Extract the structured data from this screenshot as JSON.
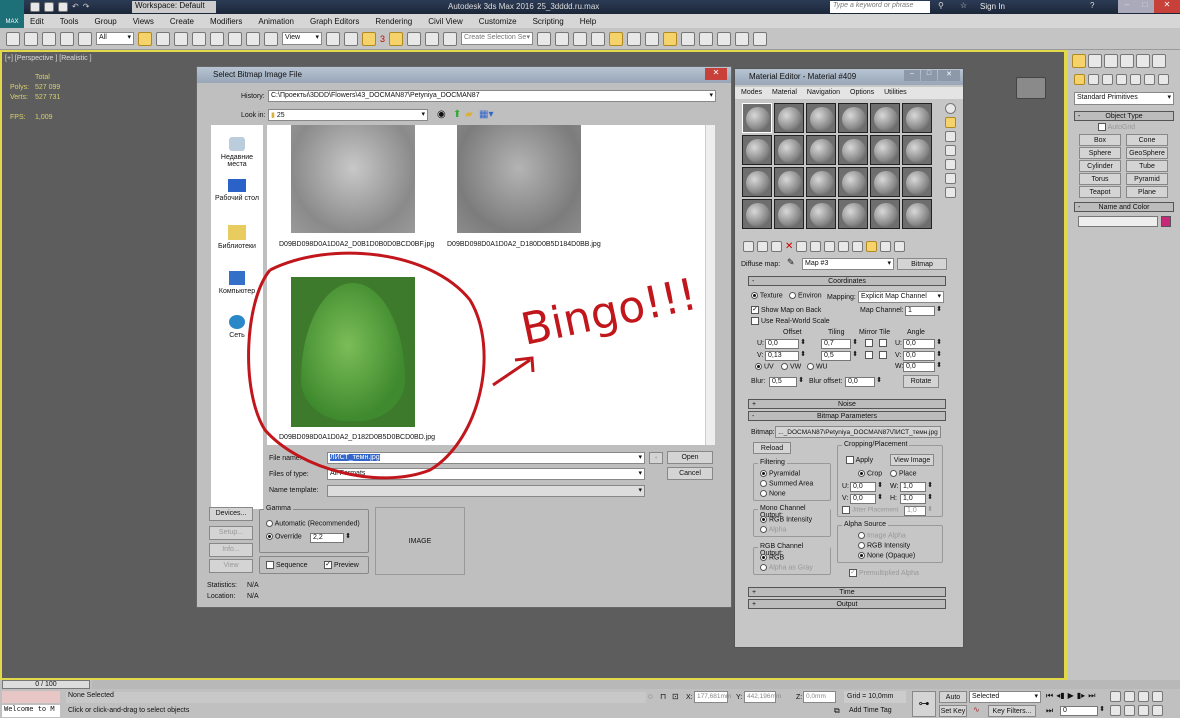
{
  "app": {
    "title": "Autodesk 3ds Max 2016",
    "file": "25_3dddd.ru.max",
    "workspace": "Workspace: Default",
    "logo": "MAX",
    "search_placeholder": "Type a keyword or phrase",
    "sign_in": "Sign In"
  },
  "menu": [
    "Edit",
    "Tools",
    "Group",
    "Views",
    "Create",
    "Modifiers",
    "Animation",
    "Graph Editors",
    "Rendering",
    "Civil View",
    "Customize",
    "Scripting",
    "Help"
  ],
  "toolbar": {
    "filter": "All",
    "ref_coord": "View",
    "selection_set_placeholder": "Create Selection Se",
    "snap_label": "3"
  },
  "viewport": {
    "label": "[+] [Perspective ] [Realistic ]",
    "stats": {
      "header": "Total",
      "polys_label": "Polys:",
      "polys": "527 099",
      "verts_label": "Verts:",
      "verts": "527 731",
      "fps_label": "FPS:",
      "fps": "1,009"
    }
  },
  "command_panel": {
    "category": "Standard Primitives",
    "object_type": "Object Type",
    "autogrid": "AutoGrid",
    "buttons": [
      "Box",
      "Cone",
      "Sphere",
      "GeoSphere",
      "Cylinder",
      "Tube",
      "Torus",
      "Pyramid",
      "Teapot",
      "Plane"
    ],
    "name_and_color": "Name and Color",
    "color": "#c8287a"
  },
  "dialog": {
    "title": "Select Bitmap Image File",
    "history_label": "History:",
    "history": "C:\\Проекты\\3DDD\\Flowers\\43_DOCMAN87\\Petyniya_DOCMAN87",
    "look_in_label": "Look in:",
    "look_in": "25",
    "places": [
      "Недавние места",
      "Рабочий стол",
      "Библиотеки",
      "Компьютер",
      "Сеть"
    ],
    "files": [
      "D09BD098D0A1D0A2_D0B1D0B0D0BCD0BF.jpg",
      "D09BD098D0A1D0A2_D180D0B5D184D0BB.jpg",
      "D09BD098D0A1D0A2_D182D0B5D0BCD0BD.jpg"
    ],
    "file_name_label": "File name:",
    "file_name": "ЛИСТ_темн.jpg",
    "files_of_type_label": "Files of type:",
    "files_of_type": "All Formats",
    "name_template_label": "Name template:",
    "open": "Open",
    "cancel": "Cancel",
    "devices": "Devices...",
    "setup": "Setup...",
    "info": "Info...",
    "view": "View",
    "gamma": "Gamma",
    "automatic": "Automatic (Recommended)",
    "override": "Override",
    "override_value": "2,2",
    "sequence": "Sequence",
    "preview": "Preview",
    "image": "IMAGE",
    "statistics_label": "Statistics:",
    "statistics": "N/A",
    "location_label": "Location:",
    "location": "N/A"
  },
  "annotation": {
    "text": "Bingo!!!",
    "color": "#c0161c"
  },
  "material_editor": {
    "title": "Material Editor - Material #409",
    "menu": [
      "Modes",
      "Material",
      "Navigation",
      "Options",
      "Utilities"
    ],
    "diffuse_label": "Diffuse map:",
    "map_name": "Map #3",
    "map_type": "Bitmap",
    "coordinates": "Coordinates",
    "texture": "Texture",
    "environ": "Environ",
    "mapping_label": "Mapping:",
    "mapping": "Explicit Map Channel",
    "show_map_back": "Show Map on Back",
    "real_world": "Use Real-World Scale",
    "map_channel_label": "Map Channel:",
    "map_channel": "1",
    "offset": "Offset",
    "tiling": "Tiling",
    "mirror_tile": "Mirror Tile",
    "angle": "Angle",
    "u_offset": "0,0",
    "v_offset": "0,13",
    "u_tiling": "0,7",
    "v_tiling": "0,5",
    "u_angle": "0,0",
    "v_angle": "0,0",
    "w_angle": "0,0",
    "uv": "UV",
    "vw": "VW",
    "wu": "WU",
    "blur_label": "Blur:",
    "blur": "0,5",
    "blur_offset_label": "Blur offset:",
    "blur_offset": "0,0",
    "rotate": "Rotate",
    "noise": "Noise",
    "bitmap_params": "Bitmap Parameters",
    "bitmap_label": "Bitmap:",
    "bitmap_path": "..._DOCMAN87\\Petyniya_DOCMAN87\\ЛИСТ_темн.jpg",
    "reload": "Reload",
    "filtering": "Filtering",
    "pyramidal": "Pyramidal",
    "summed": "Summed Area",
    "none": "None",
    "mono": "Mono Channel Output:",
    "rgb_intensity": "RGB Intensity",
    "alpha": "Alpha",
    "rgb_out": "RGB Channel Output:",
    "rgb": "RGB",
    "alpha_gray": "Alpha as Gray",
    "cropping": "Cropping/Placement",
    "apply": "Apply",
    "view_image": "View Image",
    "crop": "Crop",
    "place": "Place",
    "u": "0,0",
    "v": "0,0",
    "w": "1,0",
    "h": "1,0",
    "jitter": "Jitter Placement",
    "jitter_val": "1,0",
    "alpha_source": "Alpha Source",
    "image_alpha": "Image Alpha",
    "rgb_int2": "RGB Intensity",
    "none_opaque": "None (Opaque)",
    "premult": "Premultiplied Alpha",
    "time": "Time",
    "output": "Output"
  },
  "status": {
    "frame": "0 / 100",
    "listener": "Welcome to M",
    "selection": "None Selected",
    "prompt": "Click or click-and-drag to select objects",
    "x_label": "X:",
    "x": "177,681mm",
    "y_label": "Y:",
    "y": "442,196mm",
    "z_label": "Z:",
    "z": "0,0mm",
    "grid": "Grid = 10,0mm",
    "add_time_tag": "Add Time Tag",
    "auto_key": "Auto Key",
    "set_key": "Set Key",
    "key_mode": "Selected",
    "key_filters": "Key Filters...",
    "current_frame": "0"
  }
}
